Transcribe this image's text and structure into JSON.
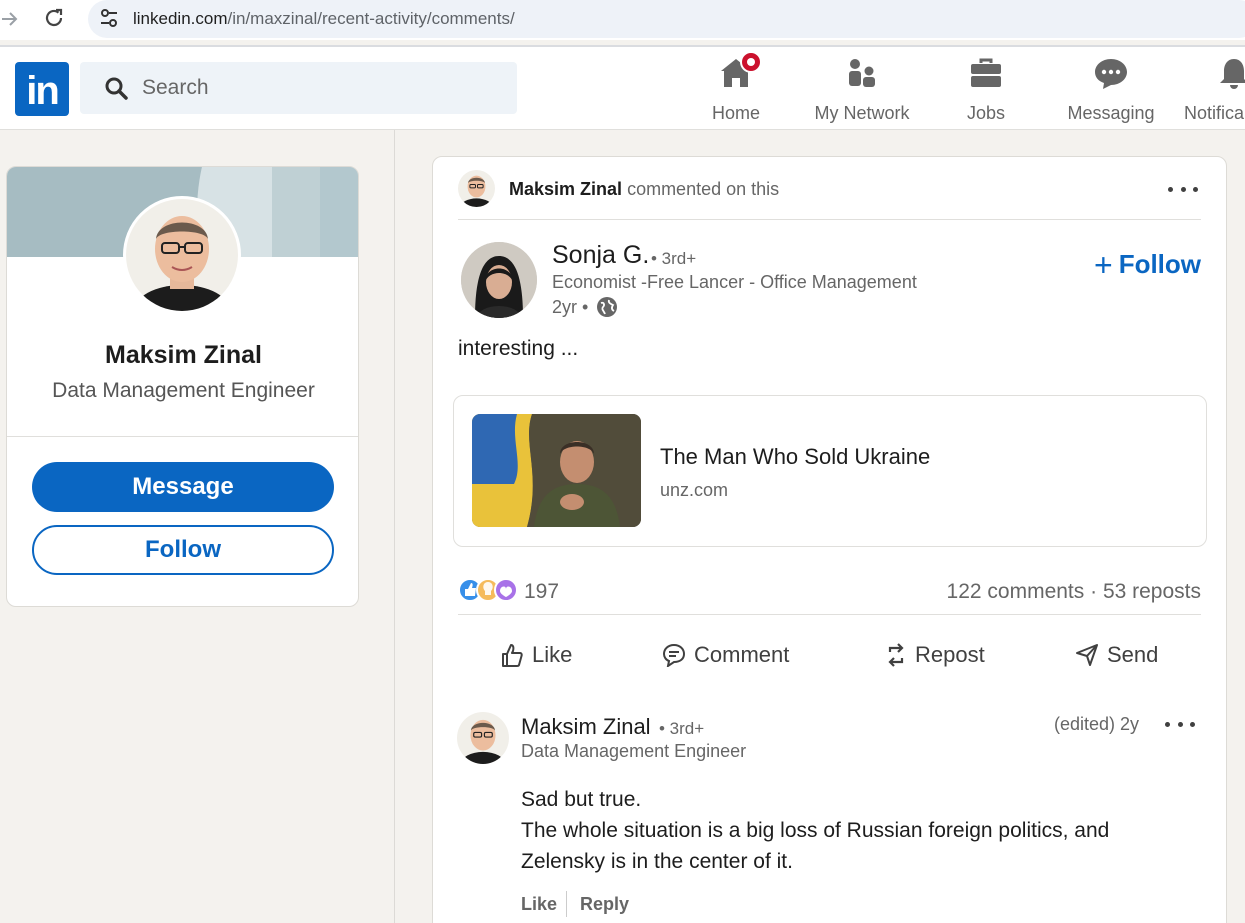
{
  "browser": {
    "url_host": "linkedin.com",
    "url_path": "/in/maxzinal/recent-activity/comments/"
  },
  "nav": {
    "logo": "in",
    "search_placeholder": "Search",
    "items": [
      {
        "label": "Home",
        "icon": "home-icon",
        "badge": true
      },
      {
        "label": "My Network",
        "icon": "my-network-icon"
      },
      {
        "label": "Jobs",
        "icon": "jobs-icon"
      },
      {
        "label": "Messaging",
        "icon": "messaging-icon"
      },
      {
        "label": "Notifica",
        "icon": "notifications-icon"
      }
    ]
  },
  "profile": {
    "name": "Maksim Zinal",
    "headline": "Data Management Engineer",
    "message_label": "Message",
    "follow_label": "Follow"
  },
  "post": {
    "context_name": "Maksim Zinal",
    "context_action": "commented on this",
    "author": {
      "name": "Sonja G.",
      "degree": "• 3rd+",
      "headline": "Economist -Free Lancer - Office Management",
      "time": "2yr •"
    },
    "follow_label": "Follow",
    "text": "interesting ...",
    "article": {
      "title": "The Man Who Sold Ukraine",
      "source": "unz.com"
    },
    "reactions_count": "197",
    "comments": "122 comments",
    "reposts": "53 reposts",
    "actions": {
      "like": "Like",
      "comment": "Comment",
      "repost": "Repost",
      "send": "Send"
    }
  },
  "comment": {
    "name": "Maksim Zinal",
    "degree": "• 3rd+",
    "headline": "Data Management Engineer",
    "time": "(edited) 2y",
    "lines": [
      "Sad but true.",
      "The whole situation is a big loss of Russian foreign politics, and",
      "Zelensky is in the center of it."
    ],
    "like_label": "Like",
    "reply_label": "Reply"
  },
  "colors": {
    "brand": "#0a66c2",
    "badge": "#cb112d",
    "page_bg": "#f4f2ee"
  }
}
